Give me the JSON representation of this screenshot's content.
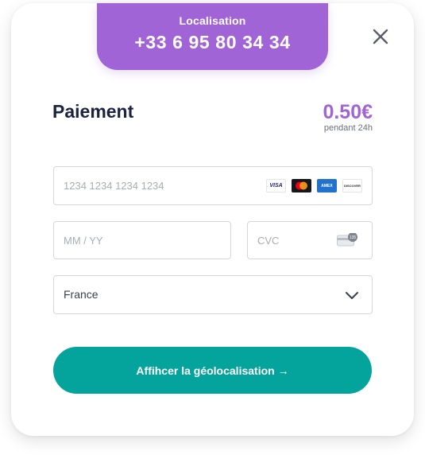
{
  "banner": {
    "label": "Localisation",
    "phone": "+33 6 95 80 34 34",
    "color": "#a064d6"
  },
  "close": {
    "icon": "close-icon"
  },
  "payment": {
    "title": "Paiement",
    "price": "0.50€",
    "price_note": "pendant 24h"
  },
  "card_number": {
    "placeholder": "1234 1234 1234 1234",
    "brands": [
      "VISA",
      "mastercard",
      "AMEX",
      "DISCOVER"
    ]
  },
  "expiry": {
    "placeholder": "MM / YY"
  },
  "cvc": {
    "placeholder": "CVC",
    "icon": "card-cvc-icon",
    "icon_text": "135"
  },
  "country": {
    "value": "France",
    "icon": "chevron-down-icon"
  },
  "cta": {
    "label": "Affihcer la géolocalisation →",
    "color": "#04a39c"
  }
}
